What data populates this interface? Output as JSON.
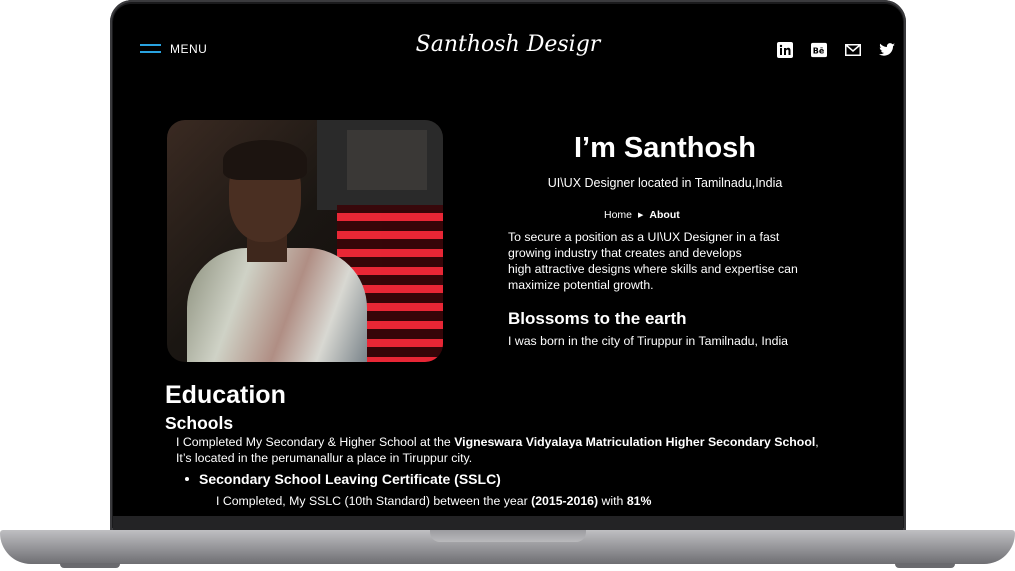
{
  "nav": {
    "menu_label": "MENU",
    "brand": "Santhosh Desigr",
    "socials": [
      "linkedin-icon",
      "behance-icon",
      "mail-icon",
      "twitter-icon"
    ]
  },
  "hero": {
    "title": "I’m Santhosh",
    "subtitle": "UI\\UX Designer located in Tamilnadu,India",
    "breadcrumb": {
      "home": "Home",
      "current": "About"
    },
    "objective_lines": [
      "To secure a position as a UI\\UX Designer in a fast",
      "growing industry that creates and develops",
      "high attractive designs where skills and expertise can",
      "maximize potential growth."
    ],
    "blossom_title": "Blossoms to the earth",
    "blossom_text": "I was born in the city of Tiruppur in Tamilnadu, India"
  },
  "education": {
    "title": "Education",
    "schools_title": "Schools",
    "school_line1_prefix": "I Completed My Secondary & Higher School at the ",
    "school_line1_bold": "Vigneswara  Vidyalaya Matriculation Higher Secondary School",
    "school_line1_suffix": ",",
    "school_line2": "It’s located in the perumanallur a place in Tiruppur city.",
    "sslc_title": "Secondary School Leaving Certificate (SSLC)",
    "sslc_prefix": "I Completed, My SSLC (10th Standard) between the year ",
    "sslc_years": "(2015-2016)",
    "sslc_mid": " with ",
    "sslc_score": "81%"
  },
  "colors": {
    "accent": "#29a3e0",
    "screen_bg": "#000000",
    "text": "#ffffff"
  }
}
